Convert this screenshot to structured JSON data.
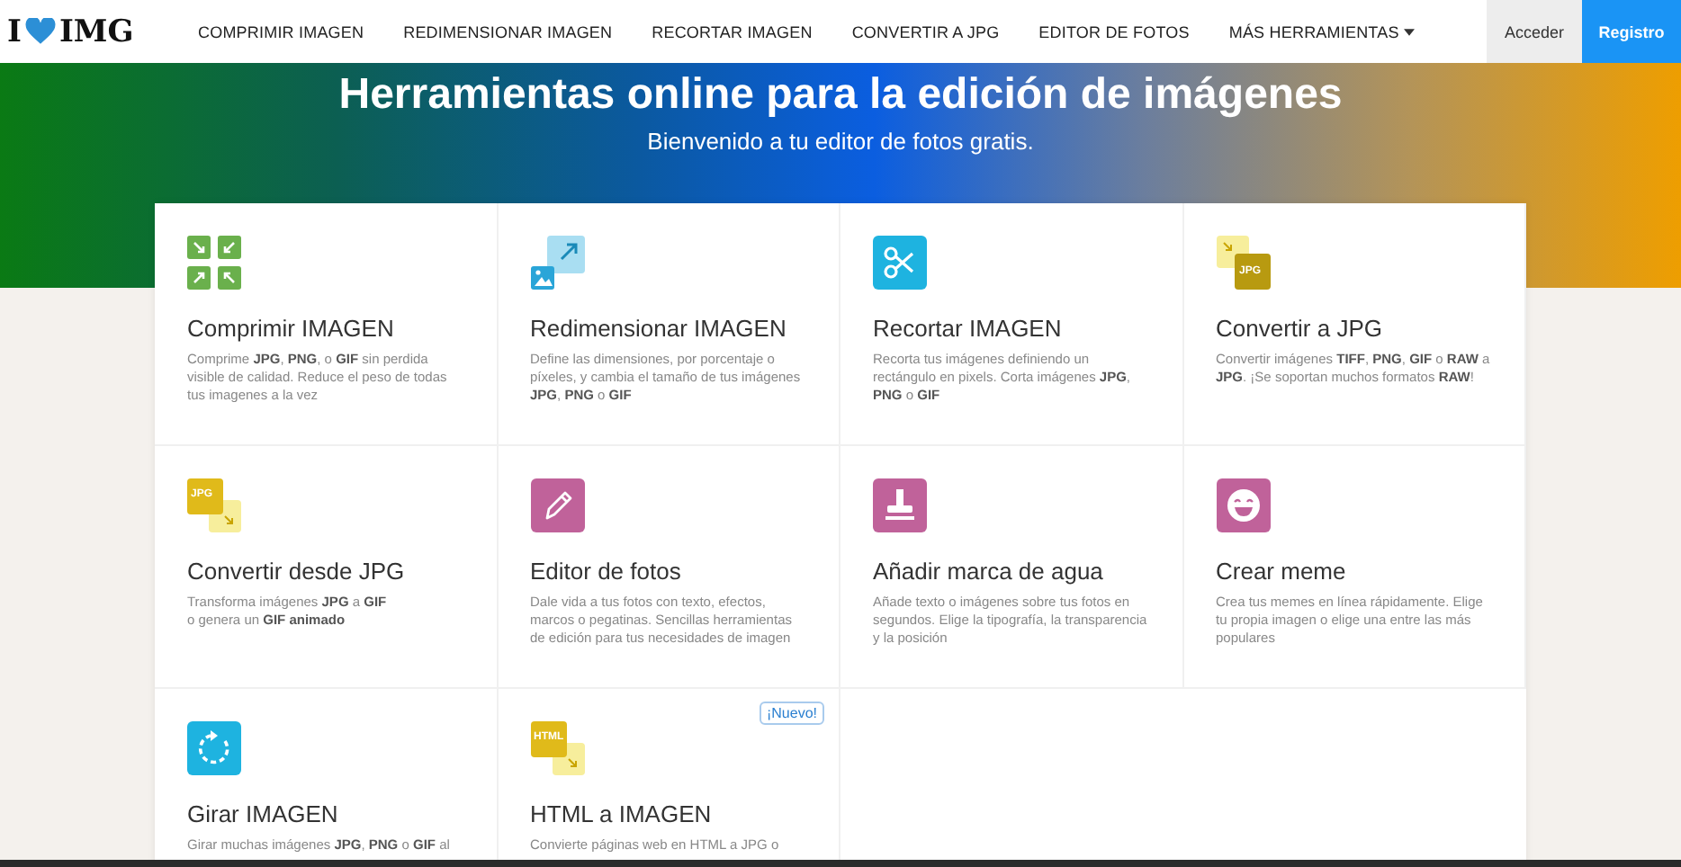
{
  "header": {
    "logo": {
      "left": "I",
      "right": "IMG"
    },
    "nav": [
      {
        "label": "COMPRIMIR IMAGEN"
      },
      {
        "label": "REDIMENSIONAR IMAGEN"
      },
      {
        "label": "RECORTAR IMAGEN"
      },
      {
        "label": "CONVERTIR A JPG"
      },
      {
        "label": "EDITOR DE FOTOS"
      },
      {
        "label": "MÁS HERRAMIENTAS",
        "dropdown": true
      }
    ],
    "login": "Acceder",
    "register": "Registro"
  },
  "hero": {
    "title": "Herramientas online para la edición de imágenes",
    "subtitle": "Bienvenido a tu editor de fotos gratis."
  },
  "tools": [
    {
      "kind": "compress",
      "title": "Comprimir IMAGEN",
      "description": "Comprime **JPG**, **PNG**, o **GIF** sin perdida visible de calidad. Reduce el peso de todas tus imagenes a la vez"
    },
    {
      "kind": "resize",
      "title": "Redimensionar IMAGEN",
      "description": "Define las dimensiones, por porcentaje o píxeles, y cambia el tamaño de tus imágenes **JPG**, **PNG** o **GIF**"
    },
    {
      "kind": "crop",
      "title": "Recortar IMAGEN",
      "description": "Recorta tus imágenes definiendo un rectángulo en pixels. Corta imágenes **JPG**, **PNG** o **GIF**"
    },
    {
      "kind": "to_jpg",
      "icon_label": "JPG",
      "title": "Convertir a JPG",
      "description": "Convertir imágenes **TIFF**, **PNG**, **GIF** o **RAW** a **JPG**. ¡Se soportan muchos formatos **RAW**!"
    },
    {
      "kind": "from_jpg",
      "icon_label": "JPG",
      "title": "Convertir desde JPG",
      "description": "Transforma imágenes **JPG** a **GIF**\no genera un **GIF animado**"
    },
    {
      "kind": "edit",
      "title": "Editor de fotos",
      "description": "Dale vida a tus fotos con texto, efectos, marcos o pegatinas. Sencillas herramientas de edición para tus necesidades de imagen"
    },
    {
      "kind": "watermark",
      "title": "Añadir marca de agua",
      "description": "Añade texto o imágenes sobre tus fotos en segundos. Elige la tipografía, la transparencia y la posición"
    },
    {
      "kind": "meme",
      "title": "Crear meme",
      "description": "Crea tus memes en línea rápidamente. Elige tu propia imagen o elige una entre las más populares"
    },
    {
      "kind": "rotate",
      "title": "Girar IMAGEN",
      "description": "Girar muchas imágenes **JPG**, **PNG** o **GIF** al"
    },
    {
      "kind": "html",
      "icon_label": "HTML",
      "badge": "¡Nuevo!",
      "title": "HTML a IMAGEN",
      "description": "Convierte páginas web en HTML a JPG o"
    }
  ]
}
